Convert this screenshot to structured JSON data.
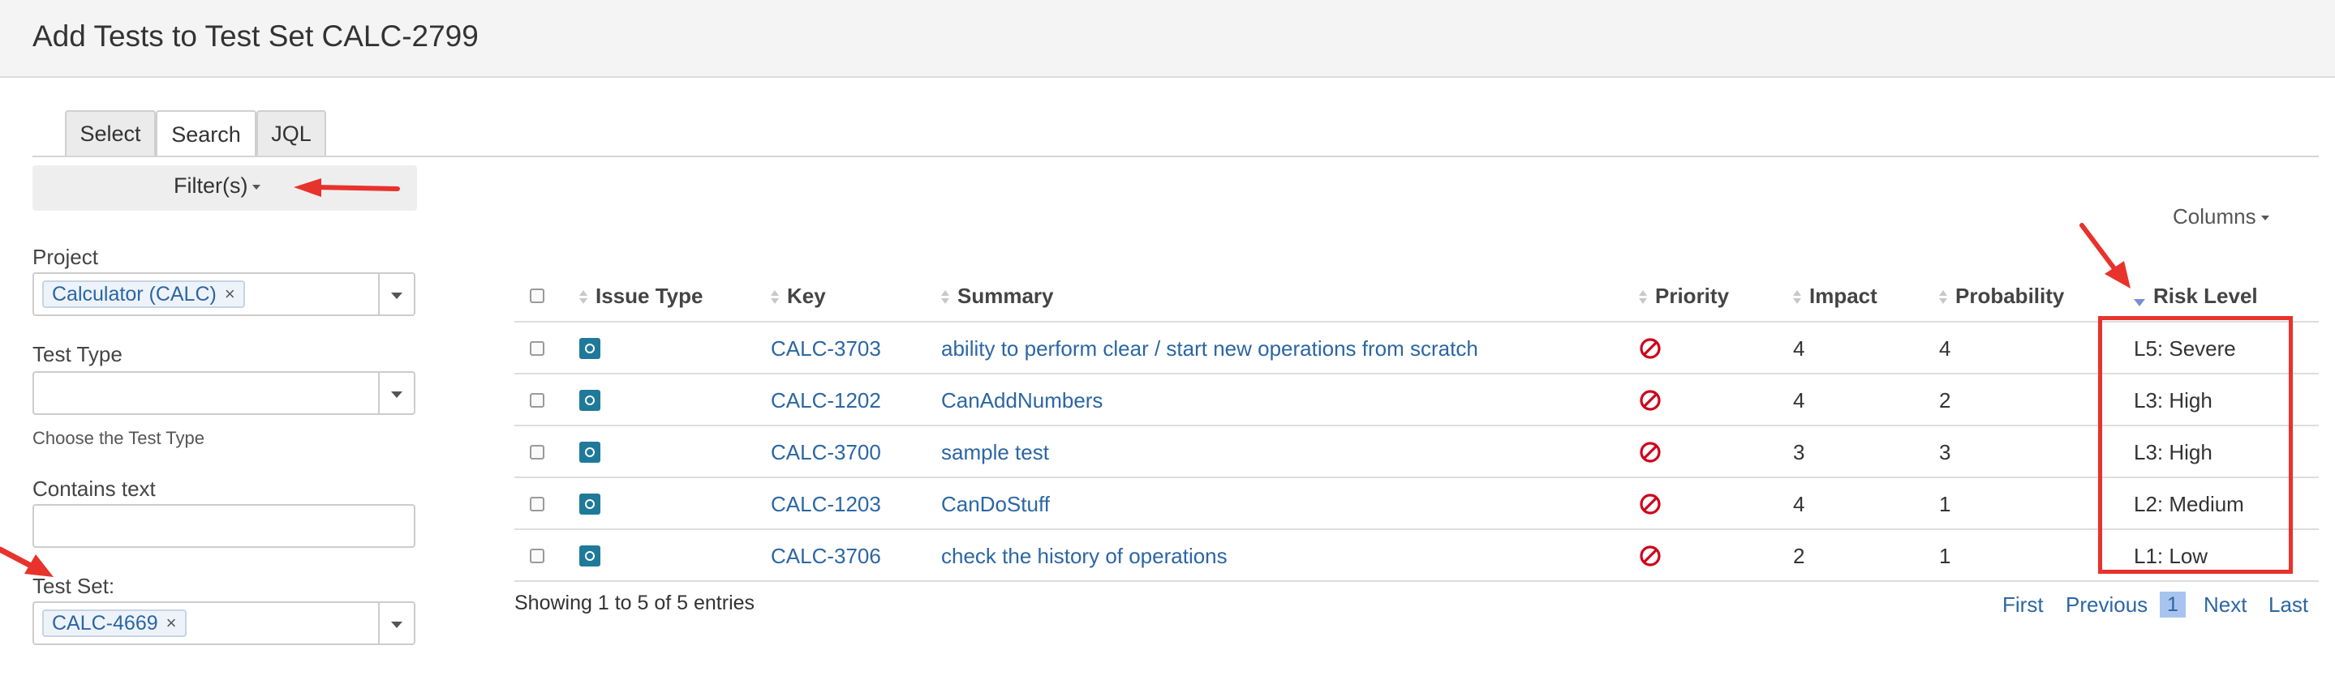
{
  "header": {
    "title": "Add Tests to Test Set CALC-2799"
  },
  "tabs": [
    {
      "label": "Select",
      "active": false
    },
    {
      "label": "Search",
      "active": true
    },
    {
      "label": "JQL",
      "active": false
    }
  ],
  "filters": {
    "toggle_label": "Filter(s)",
    "project": {
      "label": "Project",
      "value": "Calculator (CALC)",
      "remove": "×"
    },
    "test_type": {
      "label": "Test Type",
      "value": "",
      "hint": "Choose the Test Type"
    },
    "contains_text": {
      "label": "Contains text",
      "value": ""
    },
    "test_set": {
      "label": "Test Set:",
      "value": "CALC-4669",
      "remove": "×"
    }
  },
  "table": {
    "columns_button": "Columns",
    "headers": {
      "issue_type": "Issue Type",
      "key": "Key",
      "summary": "Summary",
      "priority": "Priority",
      "impact": "Impact",
      "probability": "Probability",
      "risk_level": "Risk Level"
    },
    "sorted_by": "risk-level-desc",
    "rows": [
      {
        "key": "CALC-3703",
        "summary": "ability to perform clear / start new operations from scratch",
        "impact": "4",
        "probability": "4",
        "risk": "L5: Severe"
      },
      {
        "key": "CALC-1202",
        "summary": "CanAddNumbers",
        "impact": "4",
        "probability": "2",
        "risk": "L3: High"
      },
      {
        "key": "CALC-3700",
        "summary": "sample test",
        "impact": "3",
        "probability": "3",
        "risk": "L3: High"
      },
      {
        "key": "CALC-1203",
        "summary": "CanDoStuff",
        "impact": "4",
        "probability": "1",
        "risk": "L2: Medium"
      },
      {
        "key": "CALC-3706",
        "summary": "check the history of operations",
        "impact": "2",
        "probability": "1",
        "risk": "L1: Low"
      }
    ],
    "footer": "Showing 1 to 5 of 5 entries",
    "pagination": {
      "first": "First",
      "previous": "Previous",
      "current": "1",
      "next": "Next",
      "last": "Last"
    }
  },
  "colors": {
    "link": "#2b66a3",
    "annotation_red": "#e8322c",
    "test_icon": "#1f7a9a",
    "priority_icon": "#d0021b"
  },
  "icons": {
    "issue_type": "test-issue-icon",
    "priority": "blocked-priority-icon",
    "annotations": "red-arrow-icon"
  }
}
